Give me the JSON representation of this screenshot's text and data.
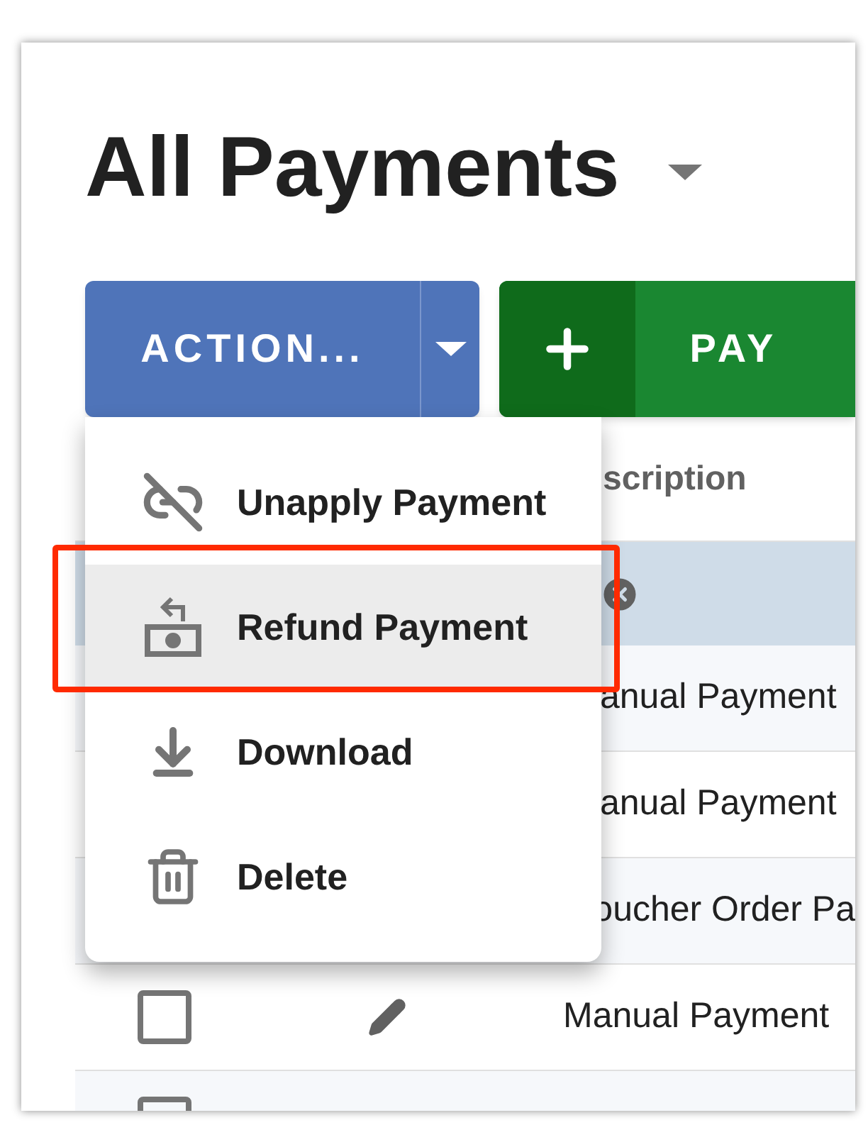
{
  "title": "All Payments",
  "action_button": {
    "label": "ACTION..."
  },
  "add_button": {
    "label": "PAY"
  },
  "table": {
    "header": "scription",
    "rows": [
      {
        "description": "anual Payment"
      },
      {
        "description": "anual Payment"
      },
      {
        "description": "oucher Order Pa"
      },
      {
        "description": "Manual Payment",
        "checked": false
      },
      {
        "checked": false
      }
    ]
  },
  "menu": {
    "items": [
      {
        "kind": "unapply",
        "label": "Unapply Payment",
        "selected": false
      },
      {
        "kind": "refund",
        "label": "Refund Payment",
        "selected": true
      },
      {
        "kind": "download",
        "label": "Download",
        "selected": false
      },
      {
        "kind": "delete",
        "label": "Delete",
        "selected": false
      }
    ]
  }
}
